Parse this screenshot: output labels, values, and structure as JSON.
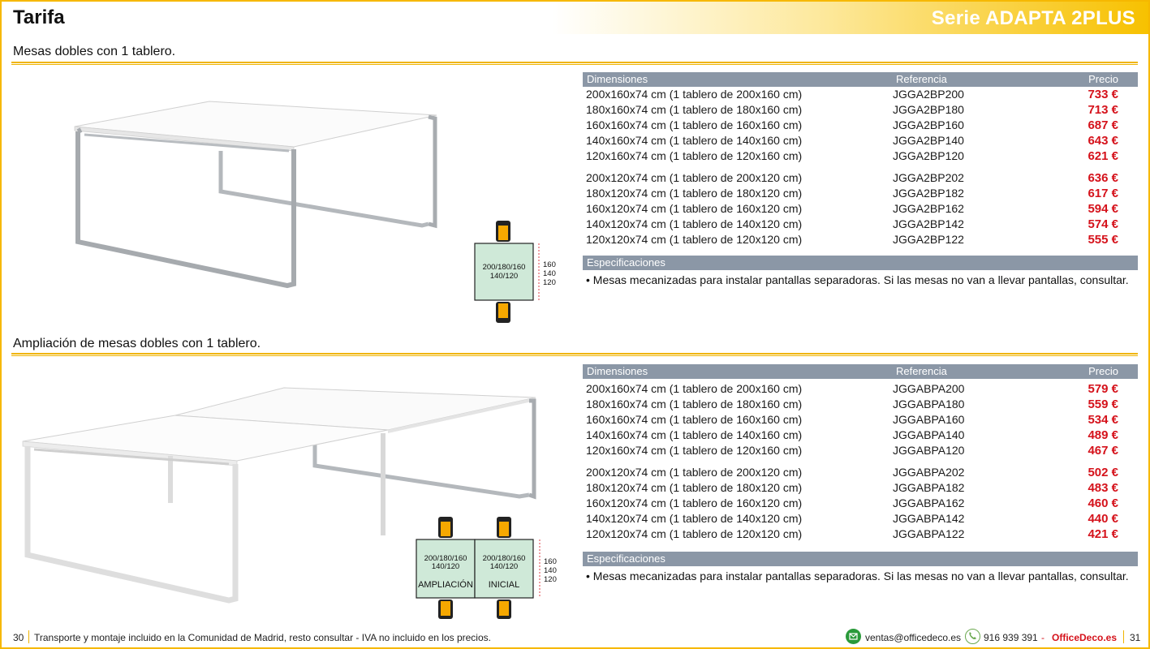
{
  "header": {
    "title": "Tarifa",
    "series": "Serie ADAPTA 2PLUS"
  },
  "sections": [
    {
      "title": "Mesas dobles con 1 tablero.",
      "table_headers": {
        "dim": "Dimensiones",
        "ref": "Referencia",
        "price": "Precio"
      },
      "group_a": [
        {
          "dim": "200x160x74 cm (1 tablero de 200x160 cm)",
          "ref": "JGGA2BP200",
          "price": "733 €"
        },
        {
          "dim": "180x160x74 cm (1 tablero de 180x160 cm)",
          "ref": "JGGA2BP180",
          "price": "713 €"
        },
        {
          "dim": "160x160x74 cm (1 tablero de 160x160 cm)",
          "ref": "JGGA2BP160",
          "price": "687 €"
        },
        {
          "dim": "140x160x74 cm (1 tablero de 140x160 cm)",
          "ref": "JGGA2BP140",
          "price": "643 €"
        },
        {
          "dim": "120x160x74 cm (1 tablero de 120x160 cm)",
          "ref": "JGGA2BP120",
          "price": "621 €"
        }
      ],
      "group_b": [
        {
          "dim": "200x120x74 cm (1 tablero de 200x120 cm)",
          "ref": "JGGA2BP202",
          "price": "636 €"
        },
        {
          "dim": "180x120x74 cm (1 tablero de 180x120 cm)",
          "ref": "JGGA2BP182",
          "price": "617 €"
        },
        {
          "dim": "160x120x74 cm (1 tablero de 160x120 cm)",
          "ref": "JGGA2BP162",
          "price": "594 €"
        },
        {
          "dim": "140x120x74 cm (1 tablero de 140x120 cm)",
          "ref": "JGGA2BP142",
          "price": "574 €"
        },
        {
          "dim": "120x120x74 cm (1 tablero de 120x120 cm)",
          "ref": "JGGA2BP122",
          "price": "555 €"
        }
      ],
      "spec_title": "Especificaciones",
      "spec_text": "• Mesas mecanizadas para instalar pantallas separadoras. Si las mesas no van a llevar pantallas, consultar.",
      "diagram": {
        "width_label_1": "200/180/160",
        "width_label_2": "140/120",
        "depth_labels": [
          "160",
          "140",
          "120"
        ]
      }
    },
    {
      "title": "Ampliación de mesas dobles con 1 tablero.",
      "table_headers": {
        "dim": "Dimensiones",
        "ref": "Referencia",
        "price": "Precio"
      },
      "group_a": [
        {
          "dim": "200x160x74 cm (1 tablero de 200x160 cm)",
          "ref": "JGGABPA200",
          "price": "579 €"
        },
        {
          "dim": "180x160x74 cm (1 tablero de 180x160 cm)",
          "ref": "JGGABPA180",
          "price": "559 €"
        },
        {
          "dim": "160x160x74 cm (1 tablero de 160x160 cm)",
          "ref": "JGGABPA160",
          "price": "534 €"
        },
        {
          "dim": "140x160x74 cm (1 tablero de 140x160 cm)",
          "ref": "JGGABPA140",
          "price": "489 €"
        },
        {
          "dim": "120x160x74 cm (1 tablero de 120x160 cm)",
          "ref": "JGGABPA120",
          "price": "467 €"
        }
      ],
      "group_b": [
        {
          "dim": "200x120x74 cm (1 tablero de 200x120 cm)",
          "ref": "JGGABPA202",
          "price": "502 €"
        },
        {
          "dim": "180x120x74 cm (1 tablero de 180x120 cm)",
          "ref": "JGGABPA182",
          "price": "483 €"
        },
        {
          "dim": "160x120x74 cm (1 tablero de 160x120 cm)",
          "ref": "JGGABPA162",
          "price": "460 €"
        },
        {
          "dim": "140x120x74 cm (1 tablero de 140x120 cm)",
          "ref": "JGGABPA142",
          "price": "440 €"
        },
        {
          "dim": "120x120x74 cm (1 tablero de 120x120 cm)",
          "ref": "JGGABPA122",
          "price": "421 €"
        }
      ],
      "spec_title": "Especificaciones",
      "spec_text": "• Mesas mecanizadas para instalar pantallas separadoras. Si las mesas no van a llevar pantallas, consultar.",
      "diagram": {
        "width_label_1": "200/180/160",
        "width_label_2": "140/120",
        "depth_labels": [
          "160",
          "140",
          "120"
        ],
        "left_label": "AMPLIACIÓN",
        "right_label": "INICIAL"
      }
    }
  ],
  "footer": {
    "page_left": "30",
    "note": "Transporte y montaje incluido en la Comunidad de Madrid, resto consultar - IVA no incluido en los precios.",
    "email": "ventas@officedeco.es",
    "phone": "916 939 391",
    "dash": "-",
    "brand": "OfficeDeco.es",
    "page_right": "31"
  },
  "colors": {
    "accent_yellow": "#f0b400",
    "table_header": "#8b97a6",
    "price_red": "#d5121b",
    "diagram_fill": "#cfe9d8",
    "chair_orange": "#f6a800"
  }
}
